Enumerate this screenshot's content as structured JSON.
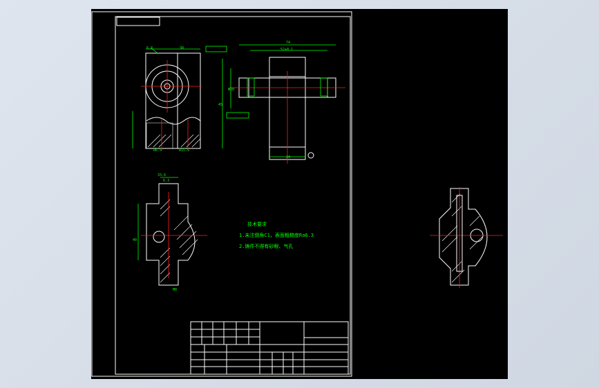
{
  "colors": {
    "background": "#d7dee8",
    "viewport": "#000000",
    "outline": "#ffffff",
    "dimension": "#00ff00",
    "centerline": "#ff2020"
  },
  "technical_notes": [
    "技术要求",
    "1.未注倒角C1，表面粗糙度Ra6.3",
    "2.铸件不得有砂眼、气孔"
  ]
}
